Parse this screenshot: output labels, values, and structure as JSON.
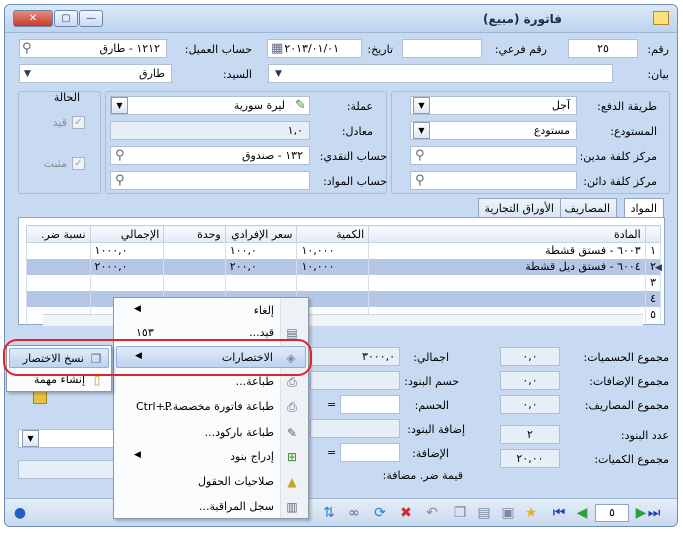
{
  "window": {
    "title": "فاتورة (مبيع)",
    "controls": {
      "close": "✕",
      "maximize": "▢",
      "minimize": "—"
    }
  },
  "header": {
    "number_label": "رقم:",
    "number_value": "٢٥",
    "sub_number_label": "رقم فرعي:",
    "sub_number_value": "",
    "date_label": "تاريخ:",
    "date_value": "٢٠١٣/٠١/٠١",
    "customer_account_label": "حساب العميل:",
    "customer_account_value": "١٢١٢ - طارق",
    "statement_label": "بيان:",
    "statement_value": "",
    "mr_label": "السيد:",
    "mr_value": "طارق"
  },
  "details": {
    "payment_method_label": "طريقة الدفع:",
    "payment_method_value": "آجل",
    "warehouse_label": "المستودع:",
    "warehouse_value": "مستودع",
    "debit_cost_center_label": "مركز كلفة مدين:",
    "credit_cost_center_label": "مركز كلفة دائن:",
    "currency_label": "عملة:",
    "currency_value": "ليرة سورية",
    "rate_label": "معادل:",
    "rate_value": "١,٠",
    "cash_account_label": "حساب النقدي:",
    "cash_account_value": "١٣٢ - صندوق",
    "materials_account_label": "حساب المواد:",
    "status_title": "الحالة",
    "posted_label": "قيد",
    "approved_label": "مثبت"
  },
  "tabs": [
    {
      "label": "المواد",
      "active": true
    },
    {
      "label": "المصاريف",
      "active": false
    },
    {
      "label": "الأوراق التجارية",
      "active": false
    }
  ],
  "grid": {
    "columns": [
      "",
      "المادة",
      "الكمية",
      "سعر الإفرادي",
      "وحدة",
      "الإجمالي",
      "نسبة ضر."
    ],
    "rows": [
      {
        "num": "١",
        "item": "٦٠٠٣ - فستق قشطة",
        "qty": "١٠,٠٠٠",
        "price": "١٠٠,٠",
        "unit": "",
        "total": "١٠٠٠,٠",
        "tax": ""
      },
      {
        "num": "٢",
        "item": "٦٠٠٤ - فستق ديل قشطة",
        "qty": "١٠,٠٠٠",
        "price": "٢٠٠,٠",
        "unit": "",
        "total": "٢٠٠٠,٠",
        "tax": ""
      },
      {
        "num": "٣",
        "item": "",
        "qty": "",
        "price": "",
        "unit": "",
        "total": "",
        "tax": ""
      },
      {
        "num": "٤",
        "item": "",
        "qty": "",
        "price": "",
        "unit": "",
        "total": "",
        "tax": ""
      },
      {
        "num": "٥",
        "item": "",
        "qty": "",
        "price": "",
        "unit": "",
        "total": "",
        "tax": ""
      }
    ]
  },
  "summary": {
    "total_label": "اجمالي:",
    "total_value": "٣٠٠٠,٠",
    "items_discount_label": "حسم البنود:",
    "discount_label": "الحسم:",
    "items_addition_label": "إضافة البنود:",
    "addition_label": "الإضافة:",
    "vat_label": "قيمة ضر. مضافة:",
    "discounts_total_label": "مجموع الحسميات:",
    "discounts_total_value": "٠,٠",
    "additions_total_label": "مجموع الإضافات:",
    "additions_total_value": "٠,٠",
    "expenses_total_label": "مجموع المصاريف:",
    "expenses_total_value": "٠,٠",
    "items_count_label": "عدد البنود:",
    "items_count_value": "٢",
    "quantities_total_label": "مجموع الكميات:",
    "quantities_total_value": "٢٠,٠٠",
    "equals": "="
  },
  "context_menu": {
    "items": [
      {
        "label": "إلغاء",
        "icon": "cancel-icon",
        "submenu": true
      },
      {
        "label": "قيد...",
        "icon": "entry-icon",
        "shortcut": "١٥٣"
      },
      {
        "label": "الاختصارات",
        "icon": "shortcuts-icon",
        "submenu": true,
        "highlighted": true
      },
      {
        "label": "طباعة...",
        "icon": "print-icon"
      },
      {
        "label": "طباعة فاتورة مخصصة...",
        "icon": "print-custom-icon",
        "shortcut": "Ctrl+P"
      },
      {
        "label": "طباعة باركود...",
        "icon": "barcode-icon"
      },
      {
        "label": "إدراج بنود",
        "icon": "insert-icon",
        "submenu": true
      },
      {
        "label": "صلاحيات الحقول",
        "icon": "lock-icon"
      },
      {
        "label": "سجل المراقبة...",
        "icon": "log-icon"
      }
    ]
  },
  "shortcuts_submenu": {
    "items": [
      {
        "label": "نسخ الاختصار",
        "icon": "copy-icon",
        "highlighted": true
      },
      {
        "label": "إنشاء مهمة",
        "icon": "task-icon"
      }
    ]
  },
  "toolbar": {
    "page_value": "٥"
  }
}
